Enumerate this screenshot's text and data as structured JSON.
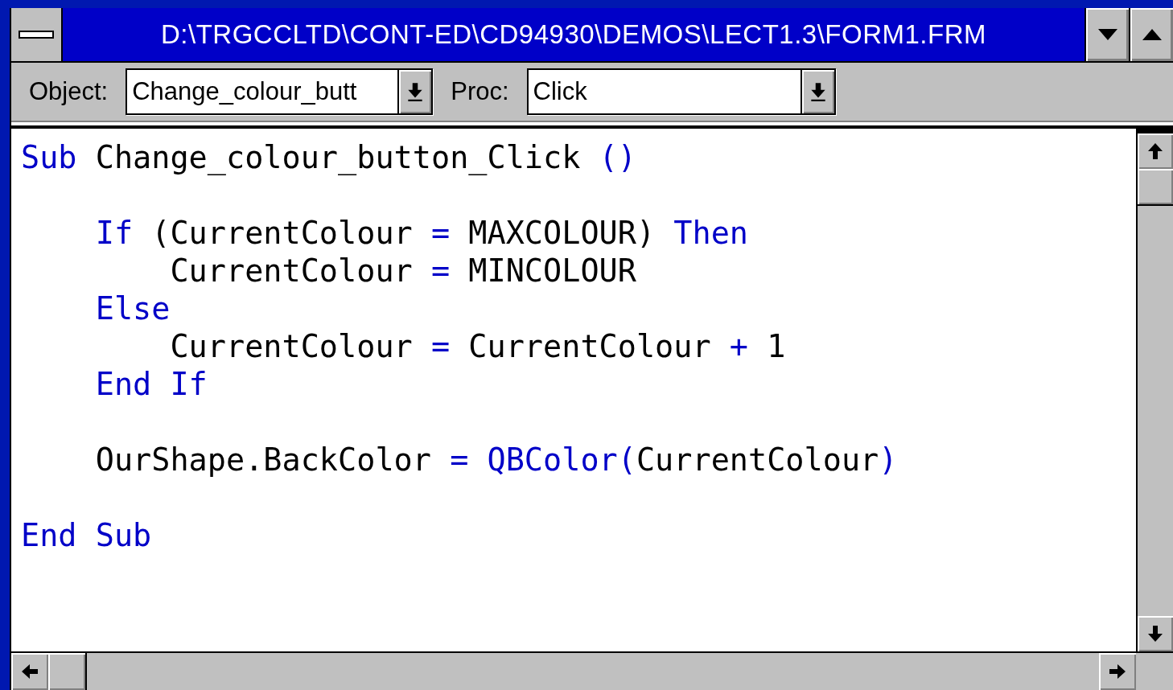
{
  "window": {
    "title": "D:\\TRGCCLTD\\CONT-ED\\CD94930\\DEMOS\\LECT1.3\\FORM1.FRM"
  },
  "toolbar": {
    "object_label": "Object:",
    "object_value": "Change_colour_butt",
    "proc_label": "Proc:",
    "proc_value": "Click"
  },
  "code": [
    {
      "kind": "code",
      "tokens": [
        {
          "text": "Sub",
          "kind": "keyword"
        },
        {
          "text": " Change_colour_button_Click ",
          "kind": "plain"
        },
        {
          "text": "()",
          "kind": "keyword"
        }
      ]
    },
    {
      "kind": "blank"
    },
    {
      "kind": "code",
      "tokens": [
        {
          "text": "    If",
          "kind": "keyword"
        },
        {
          "text": " (CurrentColour ",
          "kind": "plain"
        },
        {
          "text": "=",
          "kind": "keyword"
        },
        {
          "text": " MAXCOLOUR) ",
          "kind": "plain"
        },
        {
          "text": "Then",
          "kind": "keyword"
        }
      ]
    },
    {
      "kind": "code",
      "tokens": [
        {
          "text": "        CurrentColour ",
          "kind": "plain"
        },
        {
          "text": "=",
          "kind": "keyword"
        },
        {
          "text": " MINCOLOUR",
          "kind": "plain"
        }
      ]
    },
    {
      "kind": "code",
      "tokens": [
        {
          "text": "    Else",
          "kind": "keyword"
        }
      ]
    },
    {
      "kind": "code",
      "tokens": [
        {
          "text": "        CurrentColour ",
          "kind": "plain"
        },
        {
          "text": "=",
          "kind": "keyword"
        },
        {
          "text": " CurrentColour ",
          "kind": "plain"
        },
        {
          "text": "+",
          "kind": "keyword"
        },
        {
          "text": " 1",
          "kind": "plain"
        }
      ]
    },
    {
      "kind": "code",
      "tokens": [
        {
          "text": "    End If",
          "kind": "keyword"
        }
      ]
    },
    {
      "kind": "blank"
    },
    {
      "kind": "code",
      "tokens": [
        {
          "text": "    OurShape.BackColor ",
          "kind": "plain"
        },
        {
          "text": "= QBColor(",
          "kind": "keyword"
        },
        {
          "text": "CurrentColour",
          "kind": "plain"
        },
        {
          "text": ")",
          "kind": "keyword"
        }
      ]
    },
    {
      "kind": "blank"
    },
    {
      "kind": "code",
      "tokens": [
        {
          "text": "End Sub",
          "kind": "keyword"
        }
      ]
    }
  ]
}
